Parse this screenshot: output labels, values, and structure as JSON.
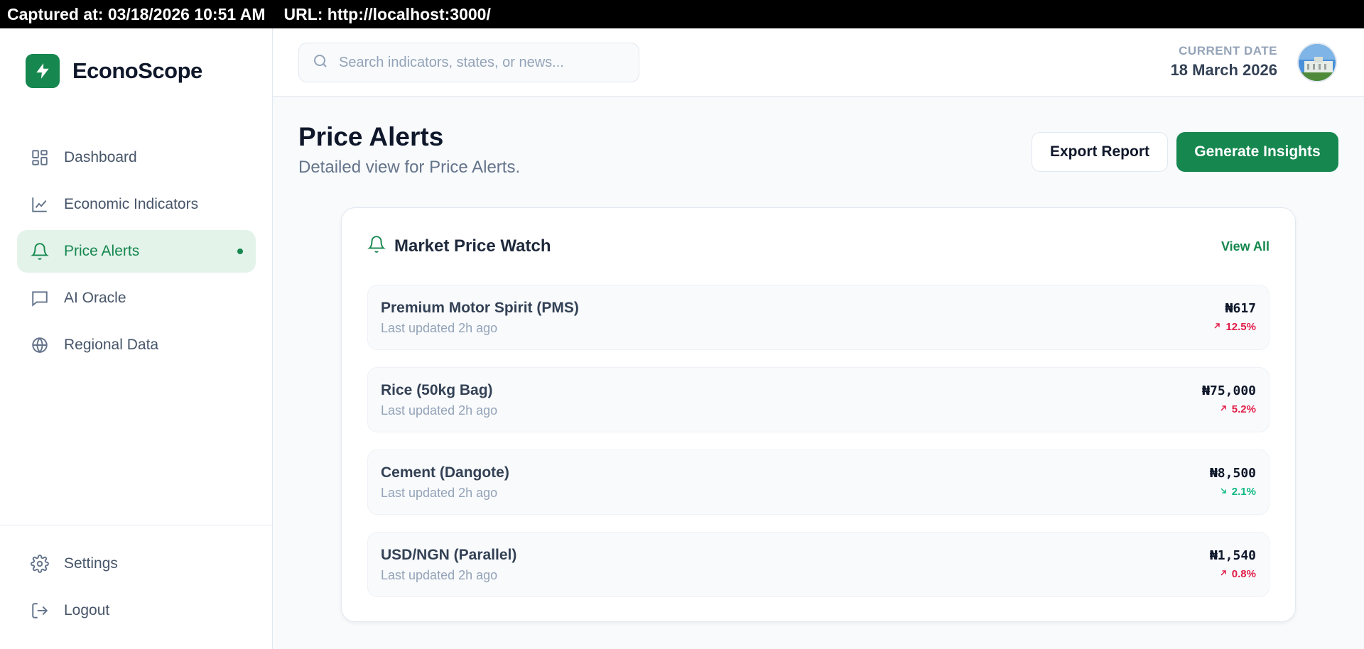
{
  "capture": {
    "timestamp": "Captured at: 03/18/2026 10:51 AM",
    "url": "URL: http://localhost:3000/"
  },
  "brand": {
    "name": "EconoScope"
  },
  "nav": {
    "items": [
      {
        "label": "Dashboard",
        "icon": "dashboard-icon"
      },
      {
        "label": "Economic Indicators",
        "icon": "line-chart-icon"
      },
      {
        "label": "Price Alerts",
        "icon": "bell-icon",
        "active": true
      },
      {
        "label": "AI Oracle",
        "icon": "message-icon"
      },
      {
        "label": "Regional Data",
        "icon": "globe-icon"
      }
    ],
    "bottom": [
      {
        "label": "Settings",
        "icon": "gear-icon"
      },
      {
        "label": "Logout",
        "icon": "logout-icon"
      }
    ]
  },
  "search": {
    "placeholder": "Search indicators, states, or news...",
    "value": ""
  },
  "date": {
    "label": "CURRENT DATE",
    "value": "18 March 2026"
  },
  "page": {
    "title": "Price Alerts",
    "subtitle": "Detailed view for Price Alerts.",
    "export_label": "Export Report",
    "generate_label": "Generate Insights"
  },
  "card": {
    "title": "Market Price Watch",
    "view_all": "View All",
    "items": [
      {
        "name": "Premium Motor Spirit (PMS)",
        "updated": "Last updated 2h ago",
        "price": "₦617",
        "change": "12.5%",
        "direction": "up"
      },
      {
        "name": "Rice (50kg Bag)",
        "updated": "Last updated 2h ago",
        "price": "₦75,000",
        "change": "5.2%",
        "direction": "up"
      },
      {
        "name": "Cement (Dangote)",
        "updated": "Last updated 2h ago",
        "price": "₦8,500",
        "change": "2.1%",
        "direction": "down"
      },
      {
        "name": "USD/NGN (Parallel)",
        "updated": "Last updated 2h ago",
        "price": "₦1,540",
        "change": "0.8%",
        "direction": "up"
      }
    ]
  },
  "colors": {
    "brand": "#16874f",
    "up": "#e11d48",
    "down": "#10b981"
  }
}
